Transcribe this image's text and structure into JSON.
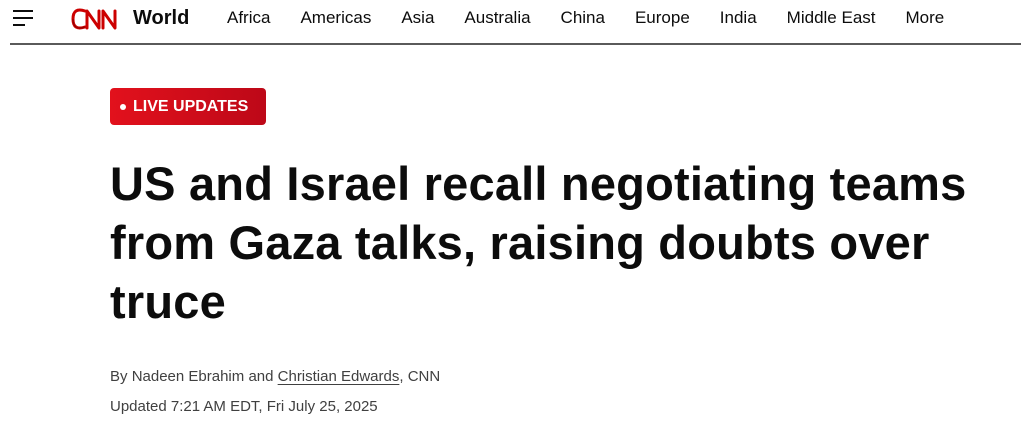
{
  "header": {
    "menu_icon": "hamburger-menu-icon",
    "logo_text": "CNN",
    "section": "World",
    "nav_items": [
      "Africa",
      "Americas",
      "Asia",
      "Australia",
      "China",
      "Europe",
      "India",
      "Middle East",
      "More"
    ]
  },
  "article": {
    "badge": "LIVE UPDATES",
    "headline": "US and Israel recall negotiating teams from Gaza talks, raising doubts over truce",
    "byline": {
      "prefix": "By",
      "author_1": "Nadeen Ebrahim",
      "joiner": "and",
      "author_2": "Christian Edwards",
      "outlet": ", CNN"
    },
    "updated": "Updated 7:21 AM EDT, Fri July 25, 2025"
  },
  "colors": {
    "brand_red": "#cc0000",
    "text_dark": "#0c0c0c",
    "text_muted": "#404040"
  }
}
